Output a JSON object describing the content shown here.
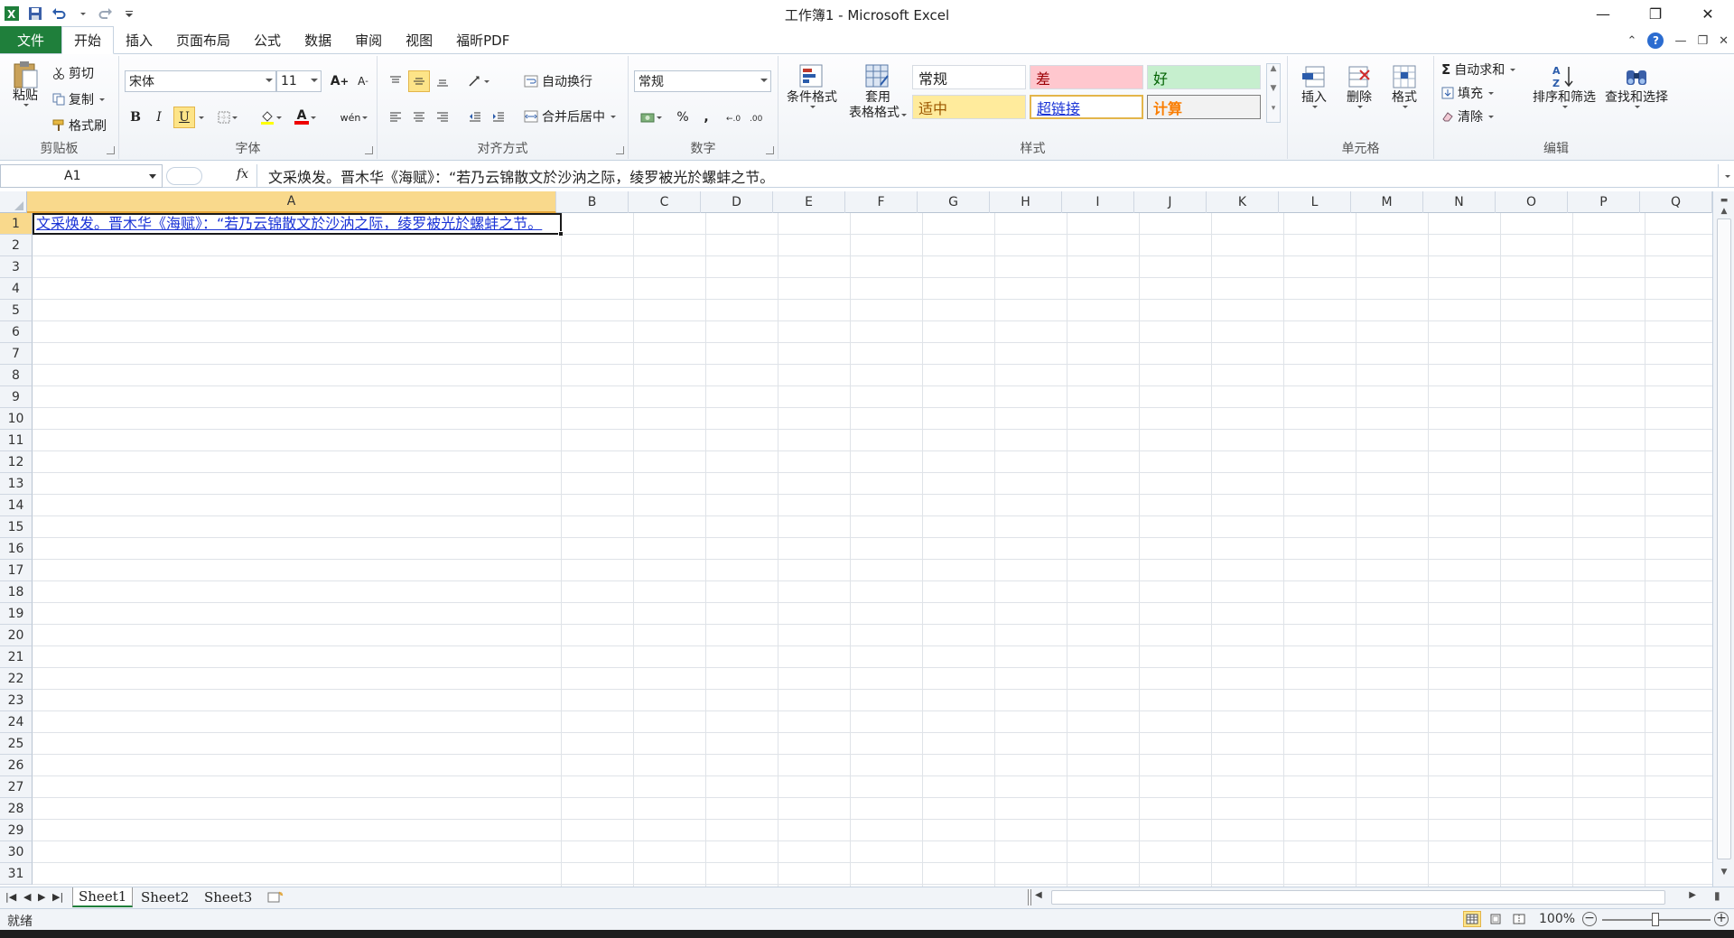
{
  "window": {
    "title": "工作簿1 - Microsoft Excel",
    "controls": [
      "—",
      "❐",
      "✕"
    ]
  },
  "qat": {
    "items": [
      "save-icon",
      "undo-icon",
      "redo-icon",
      "customize-icon"
    ]
  },
  "tabs": {
    "file": "文件",
    "items": [
      {
        "label": "开始",
        "active": true
      },
      {
        "label": "插入"
      },
      {
        "label": "页面布局"
      },
      {
        "label": "公式"
      },
      {
        "label": "数据"
      },
      {
        "label": "审阅"
      },
      {
        "label": "视图"
      },
      {
        "label": "福昕PDF"
      }
    ]
  },
  "ribbon": {
    "clipboard": {
      "label": "剪贴板",
      "paste": "粘贴",
      "cut": "剪切",
      "copy": "复制",
      "format_painter": "格式刷"
    },
    "font": {
      "label": "字体",
      "name": "宋体",
      "size": "11",
      "bold": "B",
      "italic": "I",
      "underline": "U",
      "grow": "A",
      "shrink": "A",
      "font_color": "A",
      "phonetic": "wén"
    },
    "alignment": {
      "label": "对齐方式",
      "wrap": "自动换行",
      "merge": "合并后居中"
    },
    "number": {
      "label": "数字",
      "format": "常规",
      "percent": "%",
      "comma": ","
    },
    "styles": {
      "label": "样式",
      "conditional": "条件格式",
      "table_line1": "套用",
      "table_line2": "表格格式",
      "cells": [
        {
          "label": "常规",
          "bg": "#ffffff",
          "fg": "#222222"
        },
        {
          "label": "差",
          "bg": "#ffc7ce",
          "fg": "#9c0006"
        },
        {
          "label": "好",
          "bg": "#c6efce",
          "fg": "#006100"
        },
        {
          "label": "适中",
          "bg": "#ffeb9c",
          "fg": "#9c5700"
        },
        {
          "label": "超链接",
          "bg": "#ffffff",
          "fg": "#1a33d6"
        },
        {
          "label": "计算",
          "bg": "#f2f2f2",
          "fg": "#fa7d00"
        }
      ]
    },
    "cells": {
      "label": "单元格",
      "insert": "插入",
      "delete": "删除",
      "format": "格式"
    },
    "editing": {
      "label": "编辑",
      "autosum": "自动求和",
      "fill": "填充",
      "clear": "清除",
      "sort": "排序和筛选",
      "find": "查找和选择"
    }
  },
  "formula_bar": {
    "name_box": "A1",
    "fx": "fx",
    "content": "文采焕发。晋木华《海赋》：“若乃云锦散文於沙汭之际，绫罗被光於螺蚌之节。"
  },
  "grid": {
    "columns": [
      "A",
      "B",
      "C",
      "D",
      "E",
      "F",
      "G",
      "H",
      "I",
      "J",
      "K",
      "L",
      "M",
      "N",
      "O",
      "P",
      "Q"
    ],
    "rows": [
      "1",
      "2",
      "3",
      "4",
      "5",
      "6",
      "7",
      "8",
      "9",
      "10",
      "11",
      "12",
      "13",
      "14",
      "15",
      "16",
      "17",
      "18",
      "19",
      "20",
      "21",
      "22",
      "23",
      "24",
      "25",
      "26",
      "27",
      "28",
      "29",
      "30",
      "31"
    ],
    "selected_column": "A",
    "selected_row": "1",
    "a1_text": "文采焕发。晋木华《海赋》：“若乃云锦散文於沙汭之际，绫罗被光於螺蚌之节。"
  },
  "sheets": {
    "tabs": [
      "Sheet1",
      "Sheet2",
      "Sheet3"
    ],
    "active": "Sheet1"
  },
  "status": {
    "text": "就绪",
    "zoom": "100%"
  }
}
